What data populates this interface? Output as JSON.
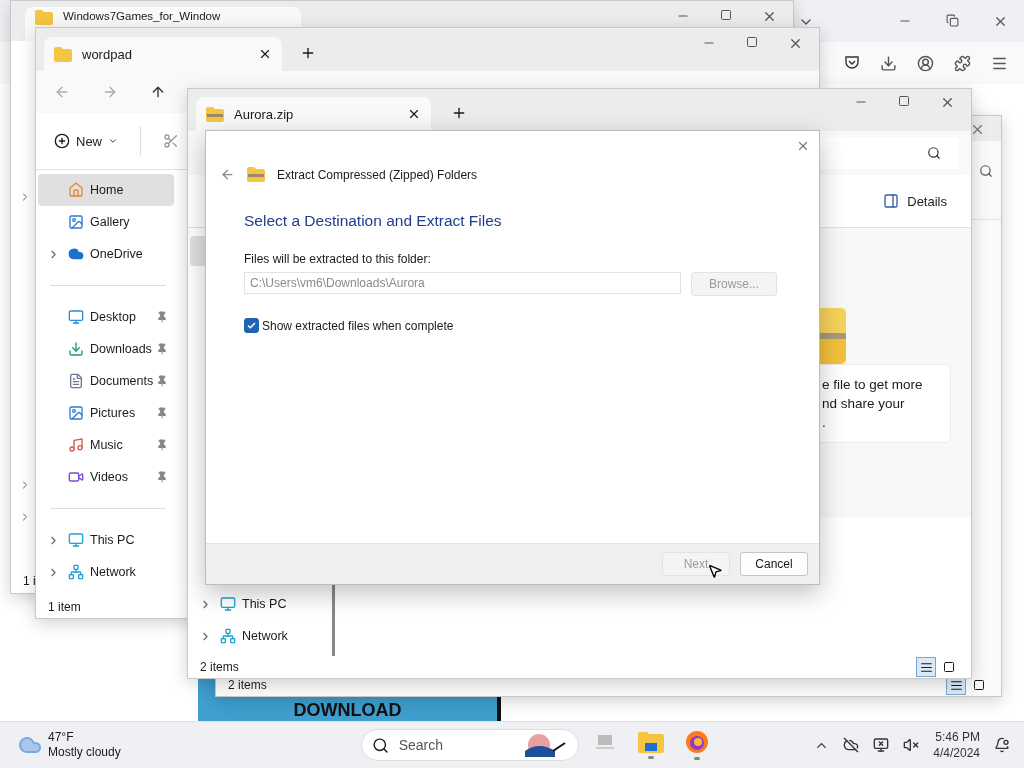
{
  "browser": {
    "banner": "DOWNLOAD"
  },
  "back_window": {
    "tab": "Windows7Games_for_Window",
    "status": "1 i"
  },
  "wordpad_window": {
    "tab": "wordpad",
    "new_button": "New",
    "status": "1 item",
    "sidebar": [
      [
        {
          "label": "Home",
          "selected": true,
          "pinned": false,
          "expandable": false
        },
        {
          "label": "Gallery",
          "selected": false,
          "pinned": false,
          "expandable": false
        },
        {
          "label": "OneDrive",
          "selected": false,
          "pinned": false,
          "expandable": true
        }
      ],
      [
        {
          "label": "Desktop",
          "selected": false,
          "pinned": true,
          "expandable": false
        },
        {
          "label": "Downloads",
          "selected": false,
          "pinned": true,
          "expandable": false
        },
        {
          "label": "Documents",
          "selected": false,
          "pinned": true,
          "expandable": false
        },
        {
          "label": "Pictures",
          "selected": false,
          "pinned": true,
          "expandable": false
        },
        {
          "label": "Music",
          "selected": false,
          "pinned": true,
          "expandable": false
        },
        {
          "label": "Videos",
          "selected": false,
          "pinned": true,
          "expandable": false
        }
      ],
      [
        {
          "label": "This PC",
          "selected": false,
          "pinned": false,
          "expandable": true
        },
        {
          "label": "Network",
          "selected": false,
          "pinned": false,
          "expandable": true
        }
      ]
    ]
  },
  "middle_window": {
    "status": "2 items",
    "views": [
      {
        "selected": true
      },
      {
        "selected": false
      }
    ]
  },
  "aurora_window": {
    "tab": "Aurora.zip",
    "details_button": "Details",
    "sidebar": [
      {
        "label": "This PC",
        "expandable": true
      },
      {
        "label": "Network",
        "expandable": true
      }
    ],
    "info": "e file to get more\nnd share your\n.",
    "status": "2 items",
    "views": [
      {
        "selected": true
      },
      {
        "selected": false
      }
    ]
  },
  "dialog": {
    "title": "Extract Compressed (Zipped) Folders",
    "heading": "Select a Destination and Extract Files",
    "folder_label": "Files will be extracted to this folder:",
    "path": "C:\\Users\\vm6\\Downloads\\Aurora",
    "browse": {
      "label": "Browse...",
      "disabled": true
    },
    "show_files": {
      "label": "Show extracted files when complete",
      "checked": true
    },
    "buttons": [
      {
        "label": "Next",
        "disabled": true
      },
      {
        "label": "Cancel",
        "disabled": false
      }
    ]
  },
  "taskbar": {
    "temperature": "47°F",
    "condition": "Mostly cloudy",
    "search": {
      "placeholder": "Search"
    },
    "apps": [
      {
        "running": false
      },
      {
        "running": true
      },
      {
        "running": true
      }
    ],
    "time": "5:46 PM",
    "date": "4/4/2024"
  }
}
